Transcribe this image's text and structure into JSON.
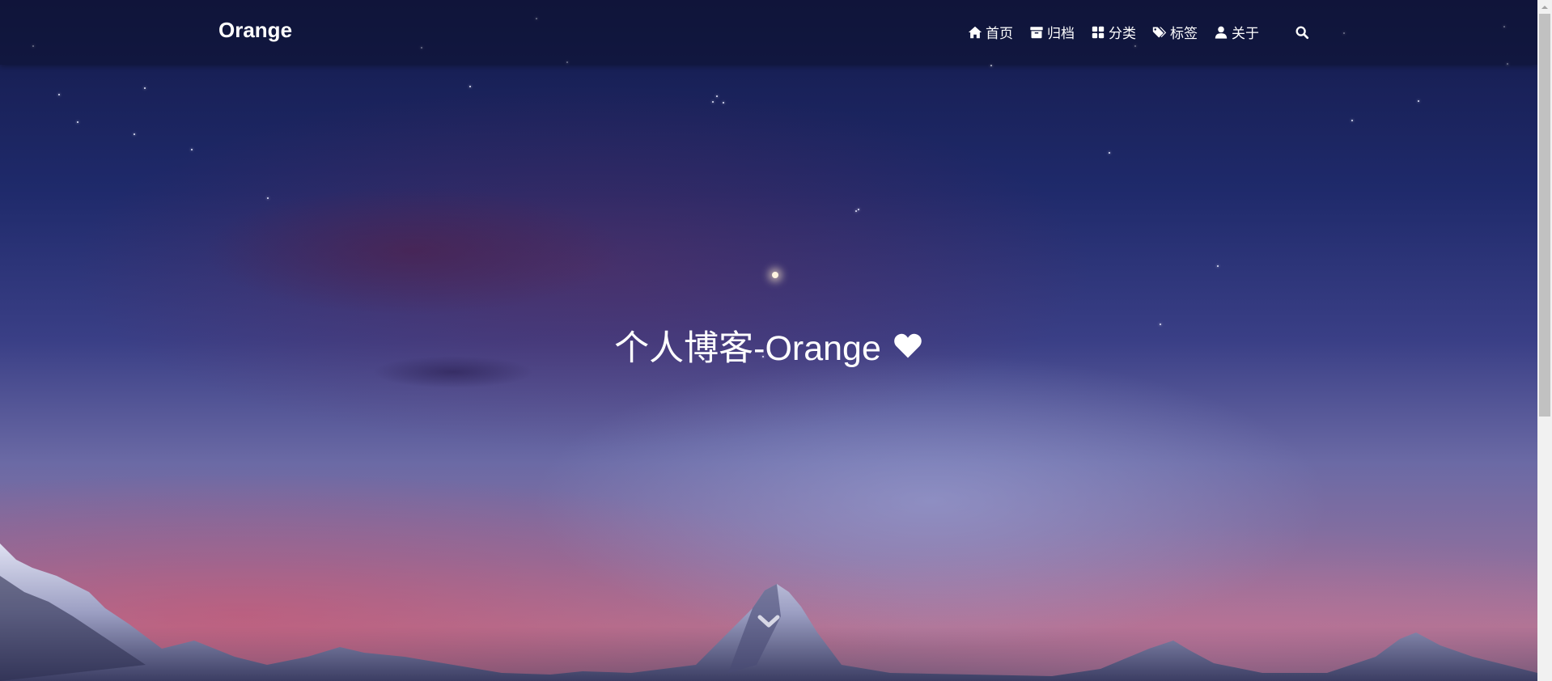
{
  "brand": "Orange",
  "nav": [
    {
      "icon": "home-icon",
      "label": "首页"
    },
    {
      "icon": "archive-icon",
      "label": "归档"
    },
    {
      "icon": "category-icon",
      "label": "分类"
    },
    {
      "icon": "tags-icon",
      "label": "标签"
    },
    {
      "icon": "user-icon",
      "label": "关于"
    }
  ],
  "search": {
    "icon": "search-icon"
  },
  "hero": {
    "title": "个人博客-Orange",
    "icon": "heart-icon",
    "scroll_icon": "chevron-down-icon"
  },
  "colors": {
    "sky_top": "#141a4a",
    "sky_mid": "#3a3f86",
    "horizon": "#b07595",
    "text": "#ffffff"
  }
}
